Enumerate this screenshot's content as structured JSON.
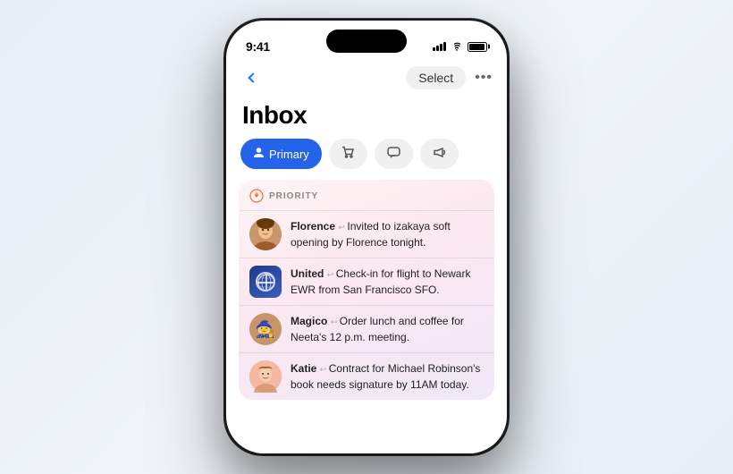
{
  "status_bar": {
    "time": "9:41",
    "battery_level": "85"
  },
  "nav": {
    "select_label": "Select",
    "more_label": "•••"
  },
  "page": {
    "title": "Inbox"
  },
  "tabs": [
    {
      "id": "primary",
      "label": "Primary",
      "icon": "person",
      "active": true
    },
    {
      "id": "shopping",
      "label": "",
      "icon": "cart",
      "active": false
    },
    {
      "id": "messages",
      "label": "",
      "icon": "bubble",
      "active": false
    },
    {
      "id": "promotions",
      "label": "",
      "icon": "megaphone",
      "active": false
    }
  ],
  "priority_section": {
    "label": "PRIORITY",
    "emails": [
      {
        "id": "florence",
        "sender": "Florence",
        "preview": "Invited to izakaya soft opening by Florence tonight.",
        "avatar_type": "photo"
      },
      {
        "id": "united",
        "sender": "United",
        "preview": "Check-in for flight to Newark EWR from San Francisco SFO.",
        "avatar_type": "logo"
      },
      {
        "id": "magico",
        "sender": "Magico",
        "preview": "Order lunch and coffee for Neeta's 12 p.m. meeting.",
        "avatar_type": "emoji"
      },
      {
        "id": "katie",
        "sender": "Katie",
        "preview": "Contract for Michael Robinson's book needs signature by 11AM today.",
        "avatar_type": "photo"
      }
    ]
  }
}
